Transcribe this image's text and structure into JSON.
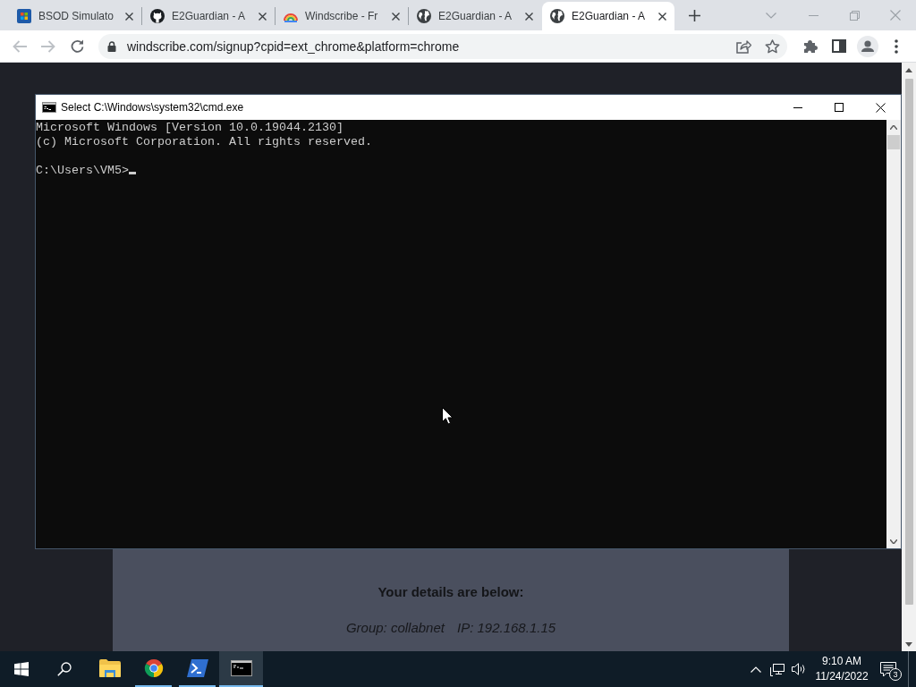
{
  "browser": {
    "tabs": [
      {
        "kind": "store",
        "title": "BSOD Simulato",
        "selected": false
      },
      {
        "kind": "github",
        "title": "E2Guardian - A",
        "selected": false
      },
      {
        "kind": "windscribe",
        "title": "Windscribe - Fr",
        "selected": false
      },
      {
        "kind": "globe",
        "title": "E2Guardian - A",
        "selected": false
      },
      {
        "kind": "globe",
        "title": "E2Guardian - A",
        "selected": true
      }
    ],
    "back": {
      "disabled": true
    },
    "forward": {
      "disabled": true
    },
    "address_bar": {
      "url": "windscribe.com/signup?cpid=ext_chrome&platform=chrome"
    }
  },
  "page": {
    "heading": "Your details are below:",
    "details": [
      "Group: collabnet",
      "IP: 192.168.1.15"
    ]
  },
  "console_window": {
    "title": "Select C:\\Windows\\system32\\cmd.exe",
    "output": [
      "Microsoft Windows [Version 10.0.19044.2130]",
      "(c) Microsoft Corporation. All rights reserved."
    ],
    "prompt": "C:\\Users\\VM5>"
  },
  "taskbar": {
    "apps": [
      {
        "kind": "explorer",
        "running": false,
        "selected": false
      },
      {
        "kind": "chrome",
        "running": true,
        "selected": false
      },
      {
        "kind": "powershell",
        "running": true,
        "selected": false
      },
      {
        "kind": "cmd",
        "running": true,
        "selected": true
      }
    ],
    "clock": {
      "time": "9:10 AM",
      "date": "11/24/2022"
    },
    "notification_count": "3"
  }
}
